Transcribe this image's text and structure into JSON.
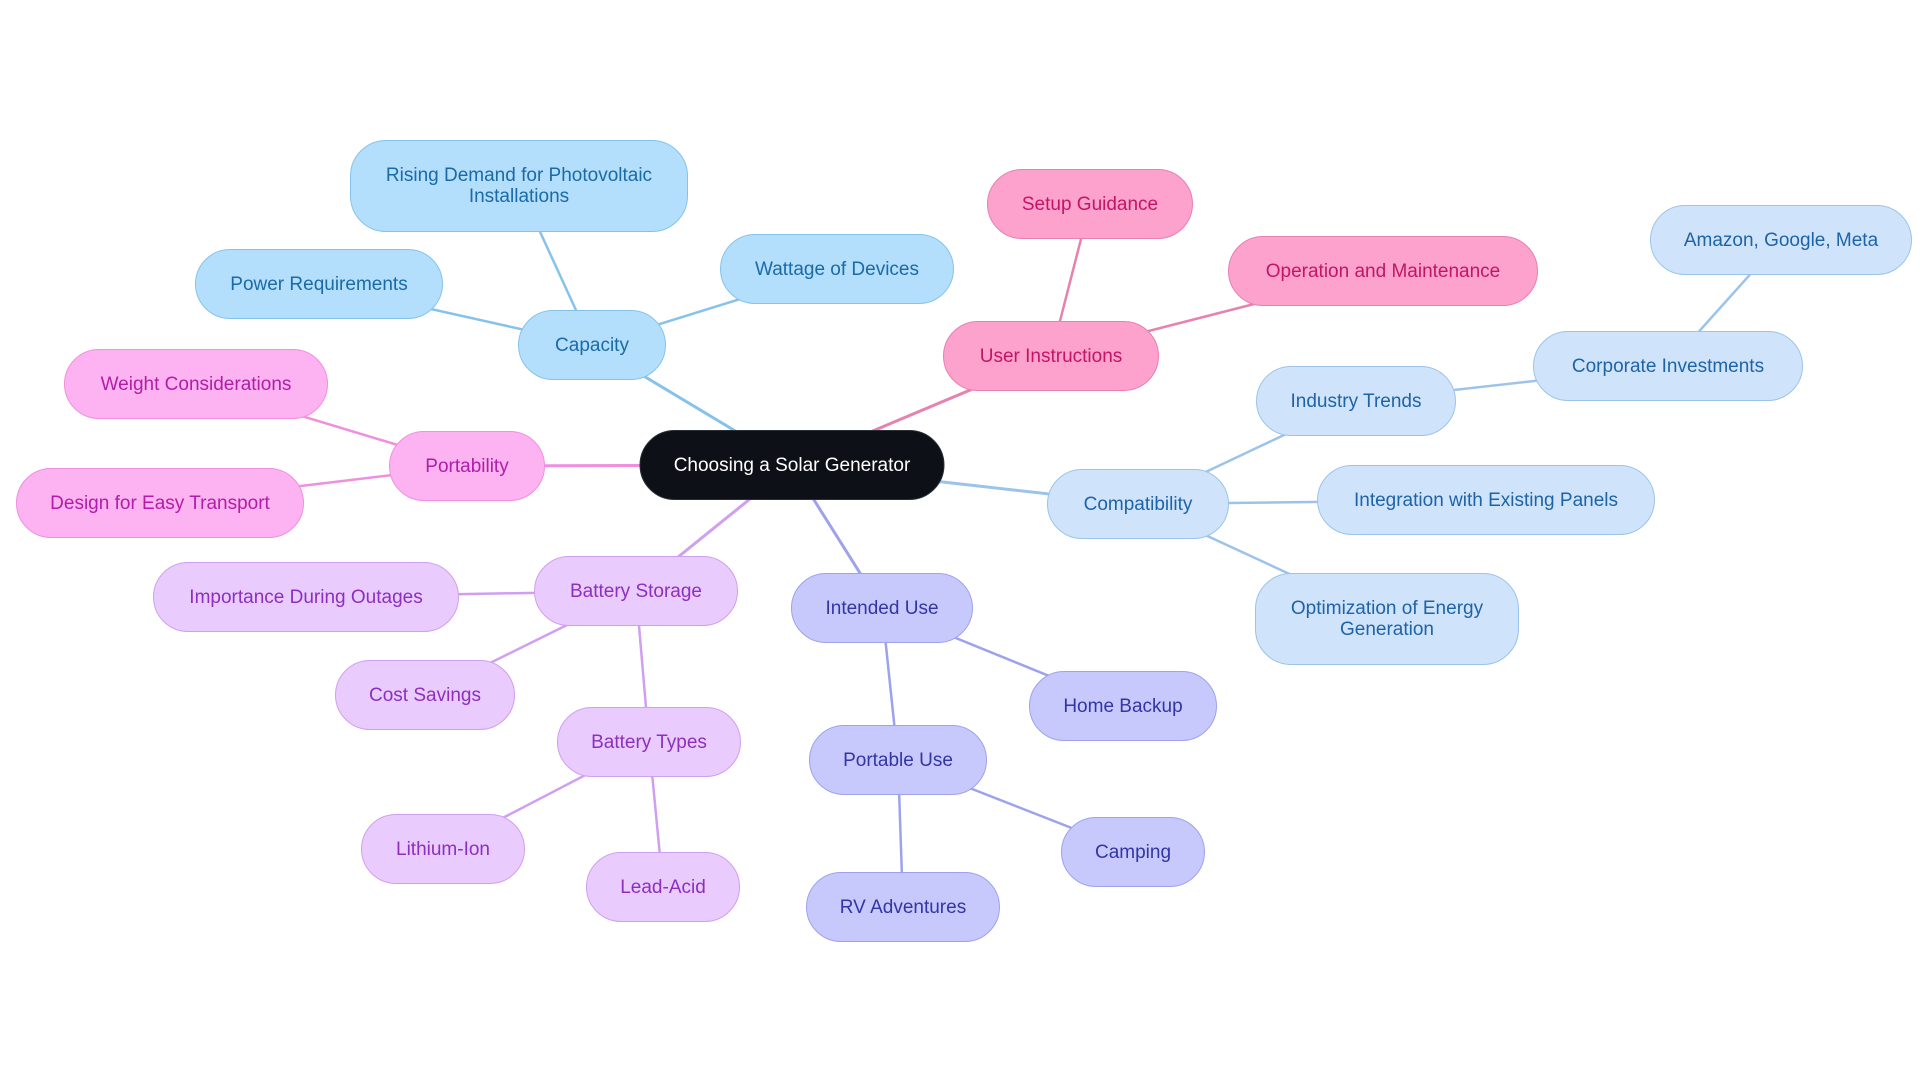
{
  "title": "Choosing a Solar Generator",
  "colors": {
    "capacity": "#86c3ea",
    "compatibility": "#9cc3ea",
    "user_instructions": "#e681b0",
    "portability": "#ef8fdd",
    "battery_storage": "#cf9ff0",
    "intended_use": "#9ea2ec"
  },
  "root": {
    "id": "root",
    "label": "Choosing a Solar Generator"
  },
  "nodes": [
    {
      "id": "capacity",
      "label": "Capacity",
      "parent": "root",
      "branch": "capacity"
    },
    {
      "id": "power-requirements",
      "label": "Power Requirements",
      "parent": "capacity",
      "branch": "capacity"
    },
    {
      "id": "rising-demand",
      "label": "Rising Demand for Photovoltaic\nInstallations",
      "parent": "capacity",
      "branch": "capacity"
    },
    {
      "id": "wattage-of-devices",
      "label": "Wattage of Devices",
      "parent": "capacity",
      "branch": "capacity"
    },
    {
      "id": "portability",
      "label": "Portability",
      "parent": "root",
      "branch": "portability"
    },
    {
      "id": "weight-considerations",
      "label": "Weight Considerations",
      "parent": "portability",
      "branch": "portability"
    },
    {
      "id": "design-for-easy-transport",
      "label": "Design for Easy Transport",
      "parent": "portability",
      "branch": "portability"
    },
    {
      "id": "user-instructions",
      "label": "User Instructions",
      "parent": "root",
      "branch": "user_instructions"
    },
    {
      "id": "setup-guidance",
      "label": "Setup Guidance",
      "parent": "user-instructions",
      "branch": "user_instructions"
    },
    {
      "id": "operation-and-maintenance",
      "label": "Operation and Maintenance",
      "parent": "user-instructions",
      "branch": "user_instructions"
    },
    {
      "id": "compatibility",
      "label": "Compatibility",
      "parent": "root",
      "branch": "compatibility"
    },
    {
      "id": "industry-trends",
      "label": "Industry Trends",
      "parent": "compatibility",
      "branch": "compatibility"
    },
    {
      "id": "corporate-investments",
      "label": "Corporate Investments",
      "parent": "industry-trends",
      "branch": "compatibility"
    },
    {
      "id": "amazon-google-meta",
      "label": "Amazon, Google, Meta",
      "parent": "corporate-investments",
      "branch": "compatibility"
    },
    {
      "id": "integration-with-existing-panels",
      "label": "Integration with Existing Panels",
      "parent": "compatibility",
      "branch": "compatibility"
    },
    {
      "id": "optimization-of-energy-generation",
      "label": "Optimization of Energy\nGeneration",
      "parent": "compatibility",
      "branch": "compatibility"
    },
    {
      "id": "battery-storage",
      "label": "Battery Storage",
      "parent": "root",
      "branch": "battery_storage"
    },
    {
      "id": "importance-during-outages",
      "label": "Importance During Outages",
      "parent": "battery-storage",
      "branch": "battery_storage"
    },
    {
      "id": "cost-savings",
      "label": "Cost Savings",
      "parent": "battery-storage",
      "branch": "battery_storage"
    },
    {
      "id": "battery-types",
      "label": "Battery Types",
      "parent": "battery-storage",
      "branch": "battery_storage"
    },
    {
      "id": "lithium-ion",
      "label": "Lithium-Ion",
      "parent": "battery-types",
      "branch": "battery_storage"
    },
    {
      "id": "lead-acid",
      "label": "Lead-Acid",
      "parent": "battery-types",
      "branch": "battery_storage"
    },
    {
      "id": "intended-use",
      "label": "Intended Use",
      "parent": "root",
      "branch": "intended_use"
    },
    {
      "id": "home-backup",
      "label": "Home Backup",
      "parent": "intended-use",
      "branch": "intended_use"
    },
    {
      "id": "portable-use",
      "label": "Portable Use",
      "parent": "intended-use",
      "branch": "intended_use"
    },
    {
      "id": "camping",
      "label": "Camping",
      "parent": "portable-use",
      "branch": "intended_use"
    },
    {
      "id": "rv-adventures",
      "label": "RV Adventures",
      "parent": "portable-use",
      "branch": "intended_use"
    }
  ]
}
